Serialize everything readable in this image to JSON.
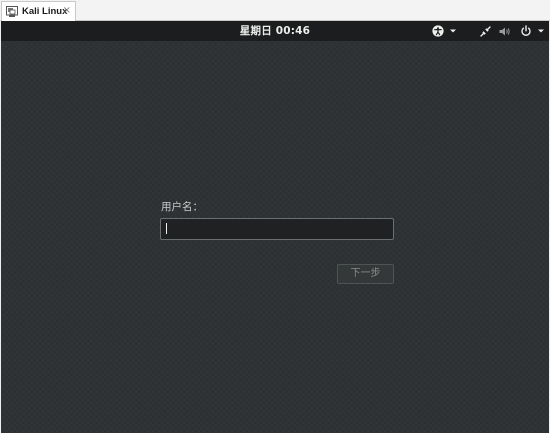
{
  "host_tab": {
    "icon": "vm-icon",
    "label": "Kali Linux",
    "close": "×"
  },
  "topbar": {
    "clock": "星期日 00:46",
    "icons": [
      "accessibility-icon",
      "chevron-down-icon",
      "network-wired-icon",
      "volume-icon",
      "power-icon",
      "chevron-down-icon"
    ]
  },
  "login": {
    "user_label": "用户名：",
    "user_value": "",
    "next_label": "下一步"
  },
  "colors": {
    "background": "#2d3133",
    "topbar": "#1b1d1e",
    "text": "#eeeeec",
    "disabled_text": "#8a8e8f"
  }
}
